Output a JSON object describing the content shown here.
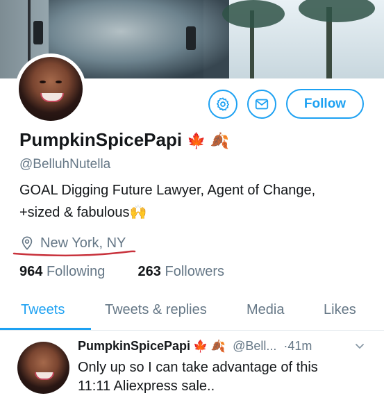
{
  "profile": {
    "display_name": "PumpkinSpicePapi",
    "name_emoji": "🍁 🍂",
    "handle": "@BelluhNutella",
    "bio_line1": "GOAL Digging Future Lawyer, Agent of Change,",
    "bio_line2": "+sized & fabulous",
    "bio_emoji": "🙌",
    "location": "New York, NY",
    "following_count": "964",
    "following_label": "Following",
    "followers_count": "263",
    "followers_label": "Followers"
  },
  "actions": {
    "follow_label": "Follow",
    "settings_icon": "gear-icon",
    "message_icon": "envelope-icon"
  },
  "tabs": [
    {
      "label": "Tweets",
      "active": true
    },
    {
      "label": "Tweets & replies",
      "active": false
    },
    {
      "label": "Media",
      "active": false
    },
    {
      "label": "Likes",
      "active": false
    }
  ],
  "tweet": {
    "name": "PumpkinSpicePapi",
    "name_emoji": "🍁 🍂",
    "handle": "@Bell...",
    "time": "·41m",
    "line1": "Only up so I can take advantage of this",
    "line2": "11:11 Aliexpress sale.."
  },
  "colors": {
    "accent": "#1da1f2",
    "secondary_text": "#657786",
    "annotation": "#c8323c"
  }
}
